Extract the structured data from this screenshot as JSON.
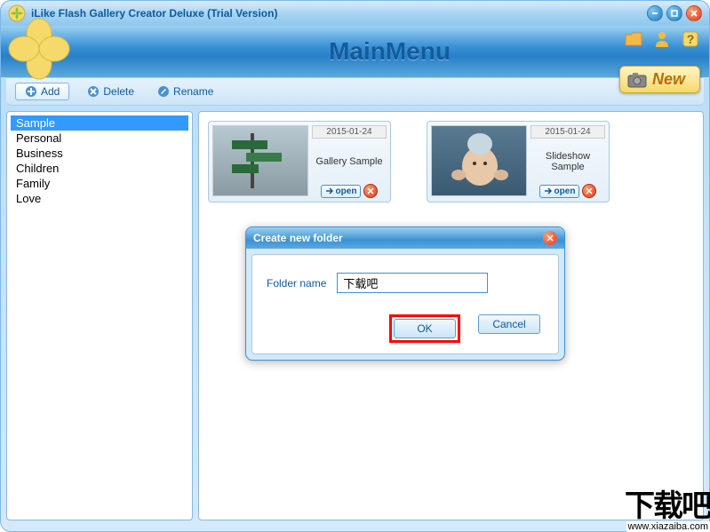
{
  "window": {
    "title": "iLike Flash Gallery Creator Deluxe (Trial Version)"
  },
  "header": {
    "main_title": "MainMenu",
    "new_label": "New"
  },
  "toolbar": {
    "add_label": "Add",
    "delete_label": "Delete",
    "rename_label": "Rename"
  },
  "sidebar": {
    "items": [
      {
        "label": "Sample",
        "selected": true
      },
      {
        "label": "Personal",
        "selected": false
      },
      {
        "label": "Business",
        "selected": false
      },
      {
        "label": "Children",
        "selected": false
      },
      {
        "label": "Family",
        "selected": false
      },
      {
        "label": "Love",
        "selected": false
      }
    ]
  },
  "gallery": {
    "items": [
      {
        "date": "2015-01-24",
        "title": "Gallery Sample",
        "open_label": "open"
      },
      {
        "date": "2015-01-24",
        "title": "Slideshow Sample",
        "open_label": "open"
      }
    ]
  },
  "dialog": {
    "title": "Create new folder",
    "label": "Folder name",
    "value": "下载吧",
    "ok_label": "OK",
    "cancel_label": "Cancel"
  },
  "watermark": {
    "text": "下载吧",
    "url": "www.xiazaiba.com"
  }
}
